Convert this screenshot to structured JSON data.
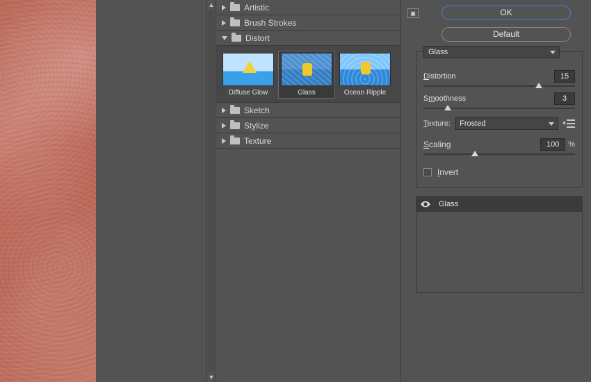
{
  "buttons": {
    "ok": "OK",
    "default": "Default"
  },
  "categories": {
    "artistic": "Artistic",
    "brush_strokes": "Brush Strokes",
    "distort": "Distort",
    "sketch": "Sketch",
    "stylize": "Stylize",
    "texture": "Texture"
  },
  "filters": {
    "diffuse_glow": "Diffuse Glow",
    "glass": "Glass",
    "ocean_ripple": "Ocean Ripple"
  },
  "selected_filter": "glass",
  "settings": {
    "filter_dropdown": "Glass",
    "distortion_label": "Distortion",
    "distortion_value": "15",
    "smoothness_label": "Smoothness",
    "smoothness_value": "3",
    "texture_label": "Texture:",
    "texture_value": "Frosted",
    "scaling_label": "Scaling",
    "scaling_value": "100",
    "scaling_unit": "%",
    "invert_label": "Invert",
    "invert_checked": false
  },
  "slider_positions": {
    "distortion_pct": 76,
    "smoothness_pct": 16,
    "scaling_pct": 34
  },
  "effect_layers": [
    {
      "name": "Glass",
      "visible": true
    }
  ],
  "colors": {
    "accent": "#4a7fe0",
    "panel": "#535353",
    "input_bg": "#3b3b3b"
  }
}
